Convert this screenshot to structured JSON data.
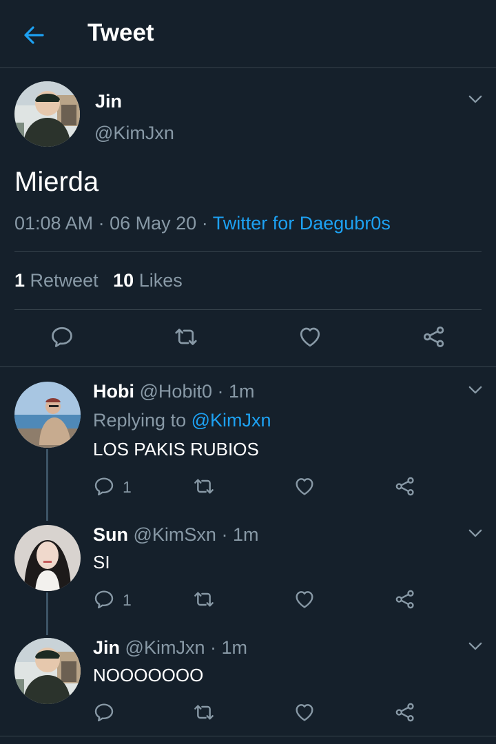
{
  "header": {
    "title": "Tweet"
  },
  "main_tweet": {
    "name": "Jin",
    "handle": "@KimJxn",
    "text": "Mierda",
    "time": "01:08 AM",
    "date": "06 May 20",
    "separator": "·",
    "client": "Twitter for Daegubr0s",
    "retweets_count": "1",
    "retweets_label": "Retweet",
    "likes_count": "10",
    "likes_label": "Likes"
  },
  "replies": [
    {
      "name": "Hobi",
      "handle": "@Hobit0",
      "time": "· 1m",
      "replying_prefix": "Replying to",
      "replying_handle": "@KimJxn",
      "text": "LOS PAKIS RUBIOS",
      "reply_count": "1"
    },
    {
      "name": "Sun",
      "handle": "@KimSxn",
      "time": "· 1m",
      "text": "SI",
      "reply_count": "1"
    },
    {
      "name": "Jin",
      "handle": "@KimJxn",
      "time": "· 1m",
      "text": "NOOOOOOO",
      "reply_count": ""
    }
  ],
  "icons": {
    "back": "arrow-left-icon",
    "caret": "chevron-down-icon",
    "reply": "comment-icon",
    "retweet": "retweet-icon",
    "like": "heart-icon",
    "share": "share-icon"
  },
  "colors": {
    "background": "#15202b",
    "accent": "#1da1f2",
    "muted": "#8899a6",
    "divider": "#38444d"
  }
}
